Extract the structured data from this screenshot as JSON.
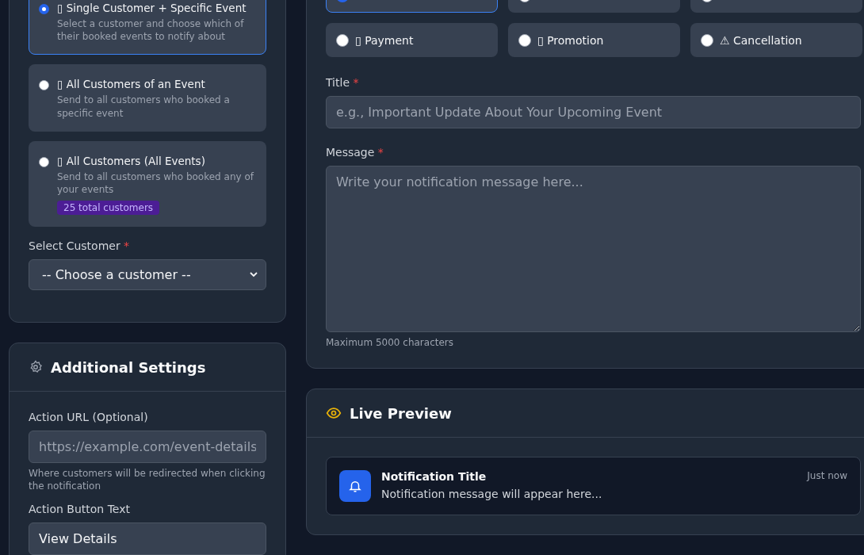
{
  "recipient_options": [
    {
      "icon": "▯",
      "title": "Single Customer + Specific Event",
      "description": "Select a customer and choose which of their booked events to notify about",
      "selected": true
    },
    {
      "icon": "▯",
      "title": "All Customers of an Event",
      "description": "Send to all customers who booked a specific event",
      "selected": false
    },
    {
      "icon": "▯",
      "title": "All Customers (All Events)",
      "description": "Send to all customers who booked any of your events",
      "badge": "25 total customers",
      "selected": false
    }
  ],
  "select_customer": {
    "label": "Select Customer",
    "required_mark": "*",
    "value": "-- Choose a customer --"
  },
  "additional_settings": {
    "title": "Additional Settings",
    "action_url": {
      "label": "Action URL (Optional)",
      "placeholder": "https://example.com/event-details",
      "hint": "Where customers will be redirected when clicking the notification"
    },
    "action_button_text": {
      "label": "Action Button Text",
      "value": "View Details"
    }
  },
  "type_options": [
    {
      "selected": true
    },
    {
      "selected": false
    },
    {
      "selected": false
    },
    {
      "icon": "▯",
      "label": "Payment",
      "selected": false
    },
    {
      "icon": "▯",
      "label": "Promotion",
      "selected": false
    },
    {
      "icon": "⚠",
      "label": "Cancellation",
      "selected": false
    }
  ],
  "title_field": {
    "label": "Title",
    "required_mark": "*",
    "placeholder": "e.g., Important Update About Your Upcoming Event"
  },
  "message_field": {
    "label": "Message",
    "required_mark": "*",
    "placeholder": "Write your notification message here...",
    "hint": "Maximum 5000 characters"
  },
  "live_preview": {
    "title": "Live Preview",
    "notification": {
      "title": "Notification Title",
      "message": "Notification message will appear here...",
      "time": "Just now"
    }
  }
}
